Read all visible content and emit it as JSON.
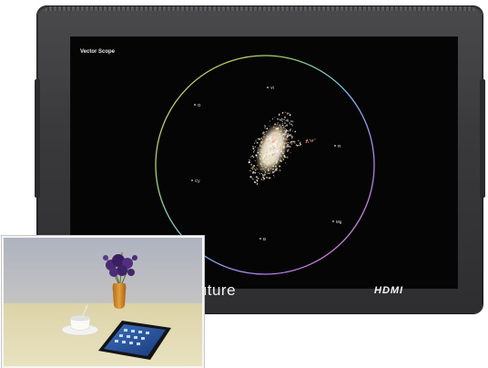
{
  "monitor": {
    "screen_title": "Vector Scope",
    "brand": "Aputure",
    "port_label": "HDMI"
  },
  "vectorscope": {
    "targets": [
      "Yl",
      "G",
      "R",
      "Cy",
      "Mg",
      "B"
    ]
  },
  "colors": {
    "bezel": "#3a3a3c",
    "screen": "#050505",
    "graticule": "#c6a2ff"
  }
}
